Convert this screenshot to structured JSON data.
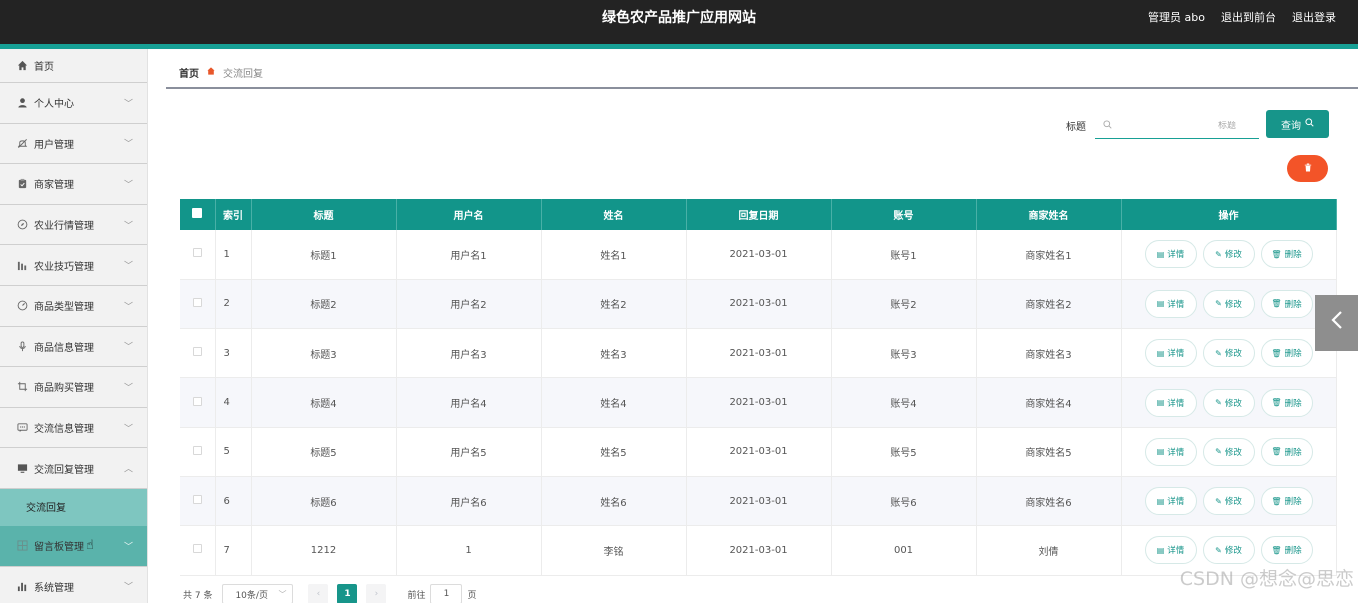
{
  "header": {
    "title": "绿色农产品推广应用网站",
    "admin": "管理员 abo",
    "back_front": "退出到前台",
    "logout": "退出登录"
  },
  "sidebar": {
    "items": [
      {
        "label": "首页",
        "icon": "home-icon"
      },
      {
        "label": "个人中心",
        "icon": "user-icon"
      },
      {
        "label": "用户管理",
        "icon": "bell-off-icon"
      },
      {
        "label": "商家管理",
        "icon": "clipboard-icon"
      },
      {
        "label": "农业行情管理",
        "icon": "compass-icon"
      },
      {
        "label": "农业技巧管理",
        "icon": "bar-chart-icon"
      },
      {
        "label": "商品类型管理",
        "icon": "gauge-icon"
      },
      {
        "label": "商品信息管理",
        "icon": "microphone-icon"
      },
      {
        "label": "商品购买管理",
        "icon": "crop-icon"
      },
      {
        "label": "交流信息管理",
        "icon": "chat-icon"
      },
      {
        "label": "交流回复管理",
        "icon": "monitor-icon"
      },
      {
        "label": "留言板管理",
        "icon": "grid-icon"
      },
      {
        "label": "系统管理",
        "icon": "chart-bars-icon"
      }
    ],
    "sub_item": "交流回复"
  },
  "breadcrumb": {
    "home": "首页",
    "current": "交流回复"
  },
  "search": {
    "label": "标题",
    "placeholder": "标题",
    "button": "查询"
  },
  "table": {
    "headers": [
      "索引",
      "标题",
      "用户名",
      "姓名",
      "回复日期",
      "账号",
      "商家姓名",
      "操作"
    ],
    "rows": [
      {
        "idx": "1",
        "title": "标题1",
        "username": "用户名1",
        "name": "姓名1",
        "date": "2021-03-01",
        "account": "账号1",
        "merchant": "商家姓名1"
      },
      {
        "idx": "2",
        "title": "标题2",
        "username": "用户名2",
        "name": "姓名2",
        "date": "2021-03-01",
        "account": "账号2",
        "merchant": "商家姓名2"
      },
      {
        "idx": "3",
        "title": "标题3",
        "username": "用户名3",
        "name": "姓名3",
        "date": "2021-03-01",
        "account": "账号3",
        "merchant": "商家姓名3"
      },
      {
        "idx": "4",
        "title": "标题4",
        "username": "用户名4",
        "name": "姓名4",
        "date": "2021-03-01",
        "account": "账号4",
        "merchant": "商家姓名4"
      },
      {
        "idx": "5",
        "title": "标题5",
        "username": "用户名5",
        "name": "姓名5",
        "date": "2021-03-01",
        "account": "账号5",
        "merchant": "商家姓名5"
      },
      {
        "idx": "6",
        "title": "标题6",
        "username": "用户名6",
        "name": "姓名6",
        "date": "2021-03-01",
        "account": "账号6",
        "merchant": "商家姓名6"
      },
      {
        "idx": "7",
        "title": "1212",
        "username": "1",
        "name": "李铭",
        "date": "2021-03-01",
        "account": "001",
        "merchant": "刘倩"
      }
    ],
    "ops": {
      "detail": "详情",
      "edit": "修改",
      "delete": "删除"
    }
  },
  "pager": {
    "total": "共 7 条",
    "page_size": "10条/页",
    "current_page": "1",
    "goto_prefix": "前往",
    "goto_value": "1",
    "goto_suffix": "页"
  },
  "watermark": "CSDN @想念@思恋",
  "colors": {
    "accent": "#17958a",
    "danger": "#f35428",
    "header_bg": "#232323"
  }
}
